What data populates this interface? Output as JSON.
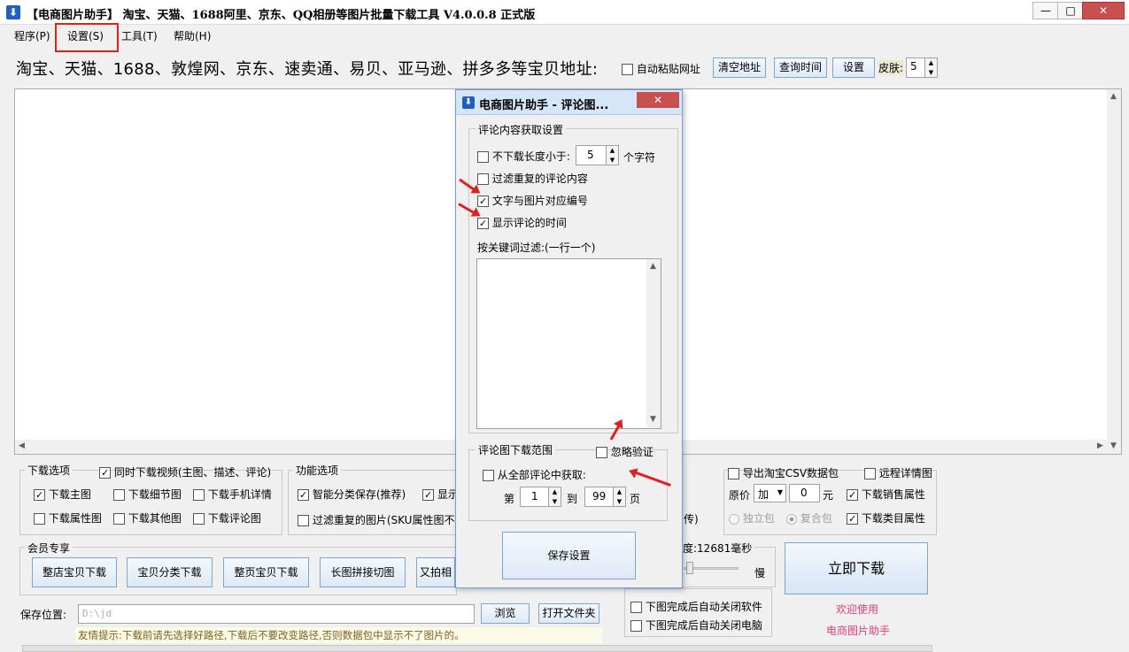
{
  "window": {
    "title": "【电商图片助手】 淘宝、天猫、1688阿里、京东、QQ相册等图片批量下载工具 V4.0.0.8 正式版",
    "minimize": "—",
    "maximize": "□",
    "close": "✕"
  },
  "menu": {
    "program": "程序(P)",
    "settings": "设置(S)",
    "tools": "工具(T)",
    "help": "帮助(H)"
  },
  "toolbar": {
    "address_label": "淘宝、天猫、1688、敦煌网、京东、速卖通、易贝、亚马逊、拼多多等宝贝地址:",
    "auto_paste": "自动粘贴网址",
    "clear_button": "清空地址",
    "query_time_button": "查询时间",
    "settings_button": "设置",
    "skin_label": "皮肤:",
    "skin_value": "5"
  },
  "download_options": {
    "title": "下载选项",
    "video": "同时下载视频(主图、描述、评论)",
    "main_image": "下载主图",
    "detail_image": "下载细节图",
    "mobile_detail": "下载手机详情",
    "attr_image": "下载属性图",
    "other_image": "下载其他图",
    "review_image": "下载评论图"
  },
  "function_options": {
    "title": "功能选项",
    "smart_save": "智能分类保存(推荐)",
    "show_partial": "显示",
    "filter_dup": "过滤重复的图片(SKU属性图不",
    "partial_right": "传)"
  },
  "right_options": {
    "export_csv": "导出淘宝CSV数据包",
    "remote_detail": "远程详情图",
    "price_label": "原价",
    "price_op": "加",
    "price_value": "0",
    "price_unit": "元",
    "sales_attr": "下载销售属性",
    "standalone": "独立包",
    "composite": "复合包",
    "category_attr": "下载类目属性"
  },
  "member": {
    "title": "会员专享",
    "whole_shop": "整店宝贝下载",
    "category_dl": "宝贝分类下载",
    "whole_page": "整页宝贝下载",
    "long_image": "长图拼接切图",
    "more": "又拍相"
  },
  "speed": {
    "label": "度:12681毫秒",
    "slow": "慢",
    "slider_fraction": 0.05
  },
  "auto_close": {
    "close_app": "下图完成后自动关闭软件",
    "close_pc": "下图完成后自动关闭电脑"
  },
  "start_button": "立即下载",
  "welcome1": "欢迎使用",
  "welcome2": "电商图片助手",
  "save": {
    "label": "保存位置:",
    "path": "D:\\jd",
    "browse": "浏览",
    "open_folder": "打开文件夹"
  },
  "tip": "友情提示:下载前请先选择好路径,下载后不要改变路径,否则数据包中显示不了图片的。",
  "dialog": {
    "title": "电商图片助手 - 评论图...",
    "close": "✕",
    "content_group": "评论内容获取设置",
    "min_length_pre": "不下载长度小于:",
    "min_length_value": "5",
    "min_length_post": "个字符",
    "filter_duplicate": "过滤重复的评论内容",
    "text_image_number": "文字与图片对应编号",
    "show_time": "显示评论的时间",
    "keyword_filter": "按关键词过滤:(一行一个)",
    "range_group": "评论图下载范围",
    "ignore_verify": "忽略验证",
    "fetch_all": "从全部评论中获取:",
    "page_from_label": "第",
    "page_from": "1",
    "page_to_label": "到",
    "page_to": "99",
    "page_unit": "页",
    "save_button": "保存设置"
  },
  "colors": {
    "highlight_red": "#e02020",
    "welcome_pink": "#e0407a",
    "dialog_accent": "#6fa0d8"
  }
}
